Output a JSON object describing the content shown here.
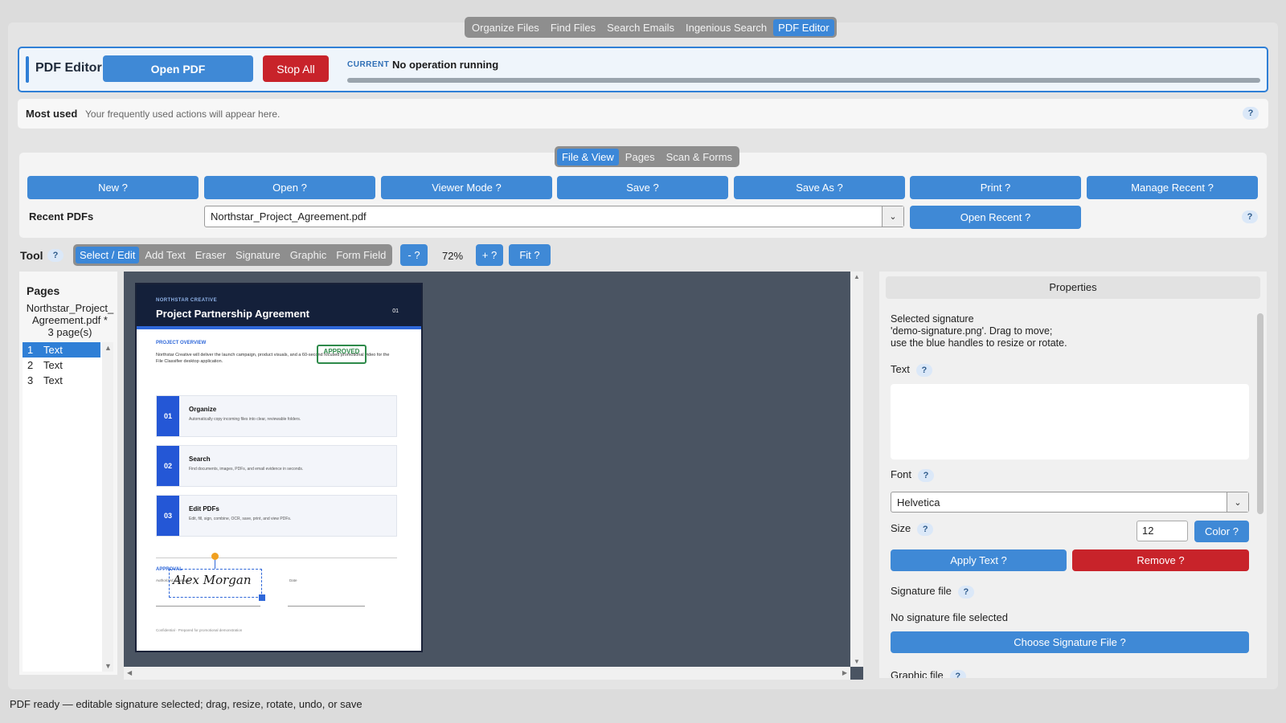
{
  "top_nav": {
    "tabs": [
      {
        "label": "Organize Files",
        "active": false
      },
      {
        "label": "Find Files",
        "active": false
      },
      {
        "label": "Search Emails",
        "active": false
      },
      {
        "label": "Ingenious Search",
        "active": false
      },
      {
        "label": "PDF Editor",
        "active": true
      }
    ]
  },
  "header": {
    "title": "PDF Editor",
    "open_pdf": "Open PDF",
    "stop_all": "Stop All",
    "current_label": "CURRENT",
    "current_value": "No operation running",
    "progress": 0.0
  },
  "most_used": {
    "label": "Most used",
    "text": "Your frequently used actions will appear here.",
    "help": "?"
  },
  "file_view": {
    "subtabs": [
      {
        "label": "File & View",
        "active": true
      },
      {
        "label": "Pages",
        "active": false
      },
      {
        "label": "Scan & Forms",
        "active": false
      }
    ],
    "actions": [
      "New ?",
      "Open ?",
      "Viewer Mode ?",
      "Save ?",
      "Save As ?",
      "Print ?",
      "Manage Recent ?"
    ],
    "recent_label": "Recent PDFs",
    "recent_value": "Northstar_Project_Agreement.pdf",
    "open_recent": "Open Recent ?",
    "help": "?"
  },
  "tool_row": {
    "label": "Tool",
    "help": "?",
    "tools": [
      {
        "label": "Select / Edit",
        "active": true
      },
      {
        "label": "Add Text",
        "active": false
      },
      {
        "label": "Eraser",
        "active": false
      },
      {
        "label": "Signature",
        "active": false
      },
      {
        "label": "Graphic",
        "active": false
      },
      {
        "label": "Form Field",
        "active": false
      }
    ],
    "zoom_out": "- ?",
    "zoom": "72%",
    "zoom_in": "+ ?",
    "fit": "Fit ?"
  },
  "pages_panel": {
    "title": "Pages",
    "filename": "Northstar_Project_Agreement.pdf *",
    "page_count": "3 page(s)",
    "pages": [
      {
        "num": "1",
        "label": "Text",
        "selected": true
      },
      {
        "num": "2",
        "label": "Text",
        "selected": false
      },
      {
        "num": "3",
        "label": "Text",
        "selected": false
      }
    ]
  },
  "document": {
    "brand": "NORTHSTAR CREATIVE",
    "title": "Project Partnership Agreement",
    "page_num": "01",
    "overview_label": "PROJECT OVERVIEW",
    "overview_text": "Northstar Creative will deliver the launch campaign, product visuals, and a 60-second focused promotional video for the File Classifier desktop application.",
    "stamp": "APPROVED",
    "cards": [
      {
        "num": "01",
        "title": "Organize",
        "desc": "Automatically copy incoming files into clear, reviewable folders."
      },
      {
        "num": "02",
        "title": "Search",
        "desc": "Find documents, images, PDFs, and email evidence in seconds."
      },
      {
        "num": "03",
        "title": "Edit PDFs",
        "desc": "Edit, fill, sign, combine, OCR, save, print, and view PDFs."
      }
    ],
    "approval_label": "APPROVAL",
    "authorized_label": "Authorized signature",
    "date_label": "Date",
    "signature": "Alex Morgan",
    "footer": "Confidential · Prepared for promotional demonstration"
  },
  "properties": {
    "title": "Properties",
    "selection_info": [
      "Selected signature",
      "'demo-signature.png'. Drag to move;",
      "use the blue handles to resize or rotate."
    ],
    "text_label": "Text",
    "font_label": "Font",
    "font_value": "Helvetica",
    "size_label": "Size",
    "size_value": "12",
    "color_button": "Color ?",
    "apply_text": "Apply Text ?",
    "remove": "Remove ?",
    "signature_file_label": "Signature file",
    "no_signature": "No signature file selected",
    "choose_signature": "Choose Signature File ?",
    "graphic_file_label": "Graphic file",
    "help": "?"
  },
  "status_bar": "PDF ready — editable signature selected; drag, resize, rotate, undo, or save",
  "colors": {
    "accent": "#3f89d6",
    "danger": "#c8232a",
    "canvas": "#4a5462"
  }
}
